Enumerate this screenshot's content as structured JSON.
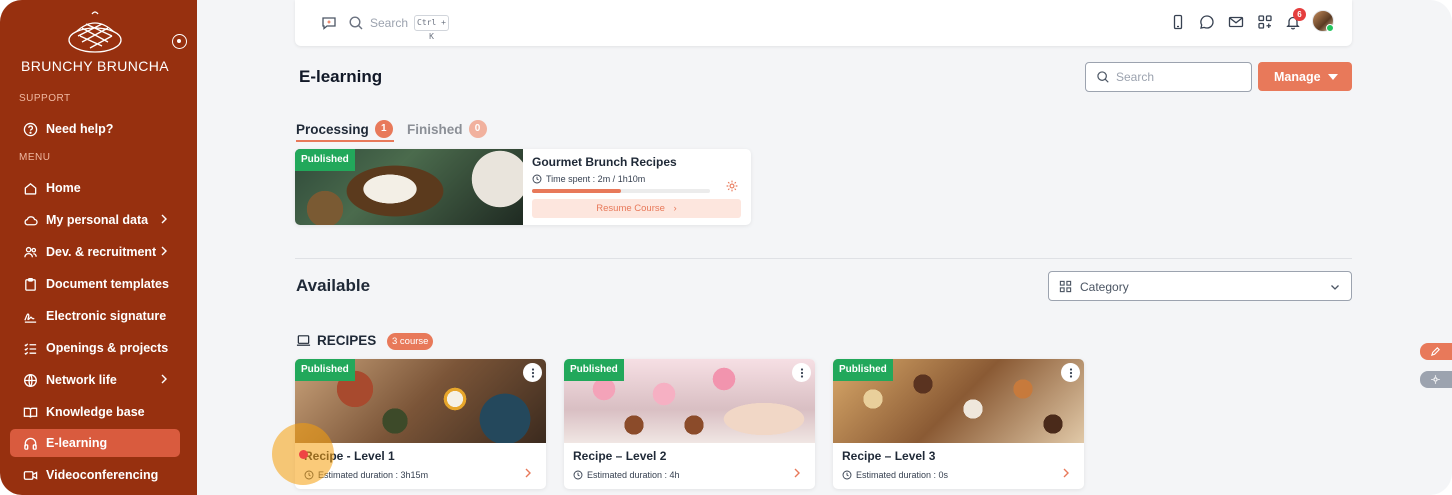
{
  "sidebar": {
    "brand": "BRUNCHY BRUNCHA",
    "support_label": "SUPPORT",
    "menu_label": "MENU",
    "help": "Need help?",
    "items": [
      {
        "label": "Home"
      },
      {
        "label": "My personal data"
      },
      {
        "label": "Dev. & recruitment"
      },
      {
        "label": "Document templates"
      },
      {
        "label": "Electronic signature"
      },
      {
        "label": "Openings & projects"
      },
      {
        "label": "Network life"
      },
      {
        "label": "Knowledge base"
      },
      {
        "label": "E-learning"
      },
      {
        "label": "Videoconferencing"
      }
    ]
  },
  "topbar": {
    "search_placeholder": "Search",
    "shortcut": "Ctrl + K",
    "notification_count": "6"
  },
  "page": {
    "title": "E-learning",
    "search_placeholder": "Search",
    "manage_label": "Manage"
  },
  "tabs": [
    {
      "label": "Processing",
      "count": "1"
    },
    {
      "label": "Finished",
      "count": "0"
    }
  ],
  "processing_course": {
    "badge": "Published",
    "title": "Gourmet Brunch Recipes",
    "time_spent": "Time spent : 2m / 1h10m",
    "progress": 0.5,
    "resume_label": "Resume Course"
  },
  "available": {
    "title": "Available",
    "category_placeholder": "Category",
    "section_title": "RECIPES",
    "section_count": "3 course",
    "courses": [
      {
        "badge": "Published",
        "title": "Recipe - Level 1",
        "duration": "Estimated duration : 3h15m"
      },
      {
        "badge": "Published",
        "title": "Recipe – Level 2",
        "duration": "Estimated duration : 4h"
      },
      {
        "badge": "Published",
        "title": "Recipe – Level 3",
        "duration": "Estimated duration : 0s"
      }
    ]
  },
  "colors": {
    "sidebar": "#97300f",
    "accent": "#e8795a",
    "published": "#22a85b"
  }
}
